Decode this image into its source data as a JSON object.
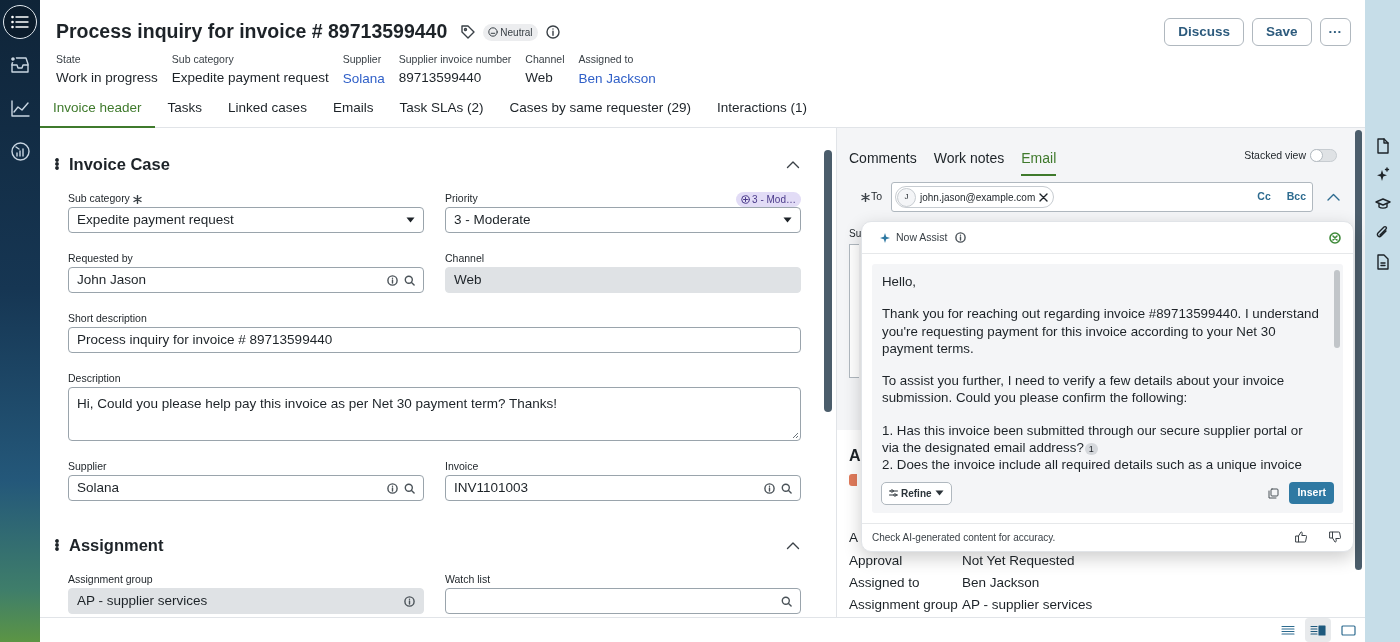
{
  "rail": {
    "items": [
      {
        "kind": "menu",
        "selected": true
      },
      {
        "kind": "inbox",
        "selected": false
      },
      {
        "kind": "chart",
        "selected": false
      },
      {
        "kind": "gauge",
        "selected": false
      }
    ]
  },
  "header": {
    "title": "Process inquiry for invoice # 89713599440",
    "sentiment": "Neutral",
    "fields": [
      {
        "label": "State",
        "value": "Work in progress",
        "kind": "text"
      },
      {
        "label": "Sub category",
        "value": "Expedite payment request",
        "kind": "text"
      },
      {
        "label": "Supplier",
        "value": "Solana",
        "kind": "link"
      },
      {
        "label": "Supplier invoice number",
        "value": "89713599440",
        "kind": "text"
      },
      {
        "label": "Channel",
        "value": "Web",
        "kind": "text"
      },
      {
        "label": "Assigned to",
        "value": "Ben Jackson",
        "kind": "link"
      }
    ],
    "buttons": [
      "Discuss",
      "Save",
      "···"
    ]
  },
  "tabs": [
    {
      "label": "Invoice header",
      "selected": true
    },
    {
      "label": "Tasks",
      "selected": false
    },
    {
      "label": "Linked cases",
      "selected": false
    },
    {
      "label": "Emails",
      "selected": false
    },
    {
      "label": "Task SLAs (2)",
      "selected": false
    },
    {
      "label": "Cases by same requester (29)",
      "selected": false
    },
    {
      "label": "Interactions (1)",
      "selected": false
    }
  ],
  "form": {
    "sections": [
      {
        "title": "Invoice Case",
        "expanded": true,
        "fields": [
          {
            "label": "Sub category",
            "required": true,
            "kind": "select",
            "value": "Expedite payment request"
          },
          {
            "label": "Priority",
            "required": false,
            "kind": "select",
            "value": "3 - Moderate",
            "badge": "3 - Mod…"
          },
          {
            "label": "Requested by",
            "required": false,
            "kind": "reference",
            "value": "John Jason"
          },
          {
            "label": "Channel",
            "required": false,
            "kind": "readonly",
            "value": "Web"
          },
          {
            "label": "Short description",
            "required": false,
            "kind": "text",
            "value": "Process inquiry for invoice # 89713599440"
          },
          {
            "label": "Description",
            "required": false,
            "kind": "textarea",
            "value": "Hi, Could you please help pay this invoice as per Net 30 payment term? Thanks!"
          },
          {
            "label": "Supplier",
            "required": false,
            "kind": "reference",
            "value": "Solana"
          },
          {
            "label": "Invoice",
            "required": false,
            "kind": "reference",
            "value": "INV1101003"
          }
        ]
      },
      {
        "title": "Assignment",
        "expanded": true,
        "fields": [
          {
            "label": "Assignment group",
            "required": false,
            "kind": "readonly-reference",
            "value": "AP - supplier services"
          },
          {
            "label": "Watch list",
            "required": false,
            "kind": "search"
          }
        ]
      }
    ]
  },
  "activity": {
    "tabs": [
      {
        "label": "Comments",
        "selected": false
      },
      {
        "label": "Work notes",
        "selected": false
      },
      {
        "label": "Email",
        "selected": true
      }
    ],
    "stacked_view": {
      "label": "Stacked view",
      "on": false
    },
    "to": {
      "label": "To",
      "required": true,
      "recipient": {
        "initial": "J",
        "email": "john.jason@example.com"
      },
      "cc": "Cc",
      "bcc": "Bcc"
    },
    "subject_label": "Su",
    "section_heading": "A",
    "details": [
      {
        "label": "A"
      },
      {
        "label": "Approval",
        "value": "Not Yet Requested"
      },
      {
        "label": "Assigned to",
        "value": "Ben Jackson"
      },
      {
        "label": "Assignment group",
        "value": "AP - supplier services"
      }
    ]
  },
  "now_assist": {
    "title": "Now Assist",
    "paragraphs": [
      {
        "text": "Hello,"
      },
      {
        "text": "Thank you for reaching out regarding invoice #89713599440. I understand you're requesting payment for this invoice according to your Net 30 payment terms."
      },
      {
        "text": "To assist you further, I need to verify a few details about your invoice submission. Could you please confirm the following:"
      },
      {
        "text": "1. Has this invoice been submitted through our secure supplier portal or via the designated email address?",
        "citation": "1",
        "kind": "item"
      },
      {
        "text": "2. Does the invoice include all required details such as a unique invoice",
        "kind": "item"
      }
    ],
    "refine": "Refine",
    "insert": "Insert",
    "disclaimer": "Check AI-generated content for accuracy."
  },
  "side_toolbar": [
    {
      "kind": "document"
    },
    {
      "kind": "sparkle"
    },
    {
      "kind": "cap"
    },
    {
      "kind": "clip"
    },
    {
      "kind": "page"
    }
  ],
  "view_switcher": [
    {
      "kind": "list",
      "selected": false
    },
    {
      "kind": "split",
      "selected": true
    },
    {
      "kind": "single",
      "selected": false
    }
  ]
}
